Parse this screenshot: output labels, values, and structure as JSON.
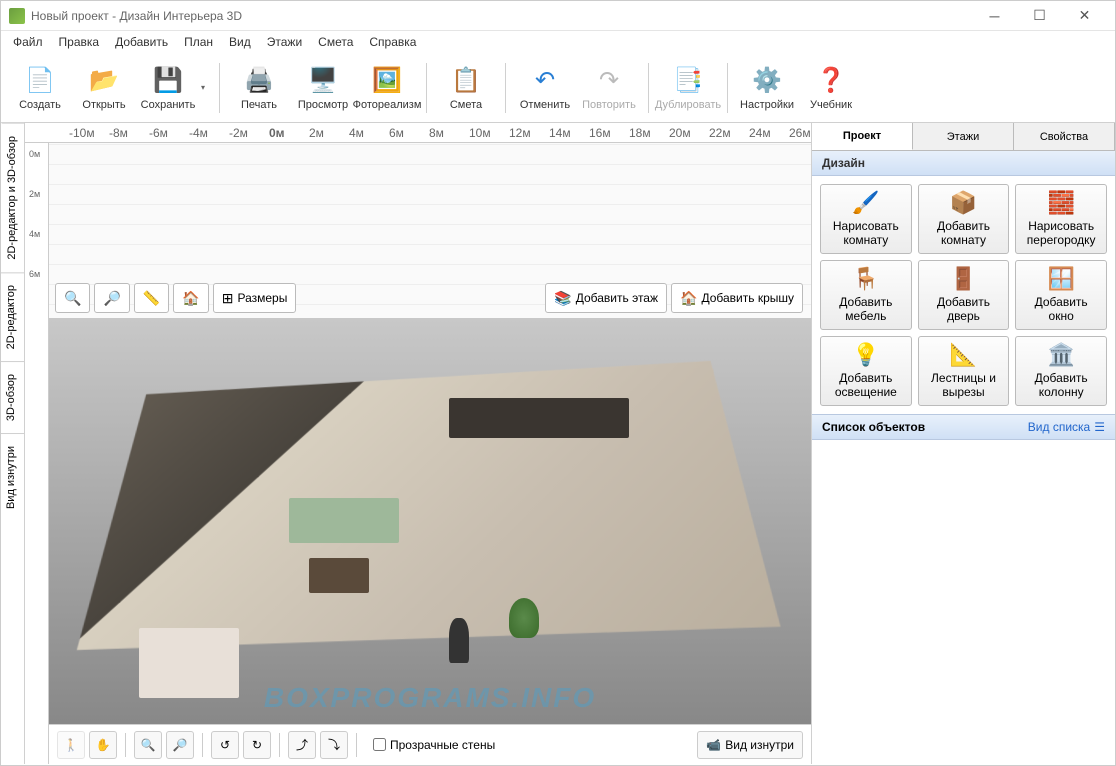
{
  "window": {
    "title": "Новый проект - Дизайн Интерьера 3D"
  },
  "menu": {
    "file": "Файл",
    "edit": "Правка",
    "add": "Добавить",
    "plan": "План",
    "view": "Вид",
    "floors": "Этажи",
    "estimate": "Смета",
    "help": "Справка"
  },
  "toolbar": {
    "create": "Создать",
    "open": "Открыть",
    "save": "Сохранить",
    "print": "Печать",
    "preview": "Просмотр",
    "photorealism": "Фотореализм",
    "estimate": "Смета",
    "undo": "Отменить",
    "redo": "Повторить",
    "duplicate": "Дублировать",
    "settings": "Настройки",
    "tutorial": "Учебник"
  },
  "left_tabs": {
    "combined": "2D-редактор и 3D-обзор",
    "editor2d": "2D-редактор",
    "view3d": "3D-обзор",
    "inside": "Вид изнутри"
  },
  "ruler": {
    "marks_h": [
      "-10м",
      "-8м",
      "-6м",
      "-4м",
      "-2м",
      "0м",
      "2м",
      "4м",
      "6м",
      "8м",
      "10м",
      "12м",
      "14м",
      "16м",
      "18м",
      "20м",
      "22м",
      "24м",
      "26м"
    ],
    "marks_v": [
      "0м",
      "2м",
      "4м",
      "6м"
    ]
  },
  "canvas_toolbar": {
    "sizes": "Размеры",
    "add_floor": "Добавить этаж",
    "add_roof": "Добавить крышу"
  },
  "bottom": {
    "transparent_walls": "Прозрачные стены",
    "inside_view": "Вид изнутри"
  },
  "right_panel": {
    "tabs": {
      "project": "Проект",
      "floors": "Этажи",
      "properties": "Свойства"
    },
    "design_header": "Дизайн",
    "buttons": {
      "draw_room": "Нарисовать\nкомнату",
      "add_room": "Добавить\nкомнату",
      "draw_partition": "Нарисовать\nперегородку",
      "add_furniture": "Добавить\nмебель",
      "add_door": "Добавить\nдверь",
      "add_window": "Добавить\nокно",
      "add_lighting": "Добавить\nосвещение",
      "stairs_cutouts": "Лестницы и\nвырезы",
      "add_column": "Добавить\nколонну"
    },
    "objects_header": "Список объектов",
    "list_view": "Вид списка"
  },
  "watermark": "BOXPROGRAMS.INFO"
}
